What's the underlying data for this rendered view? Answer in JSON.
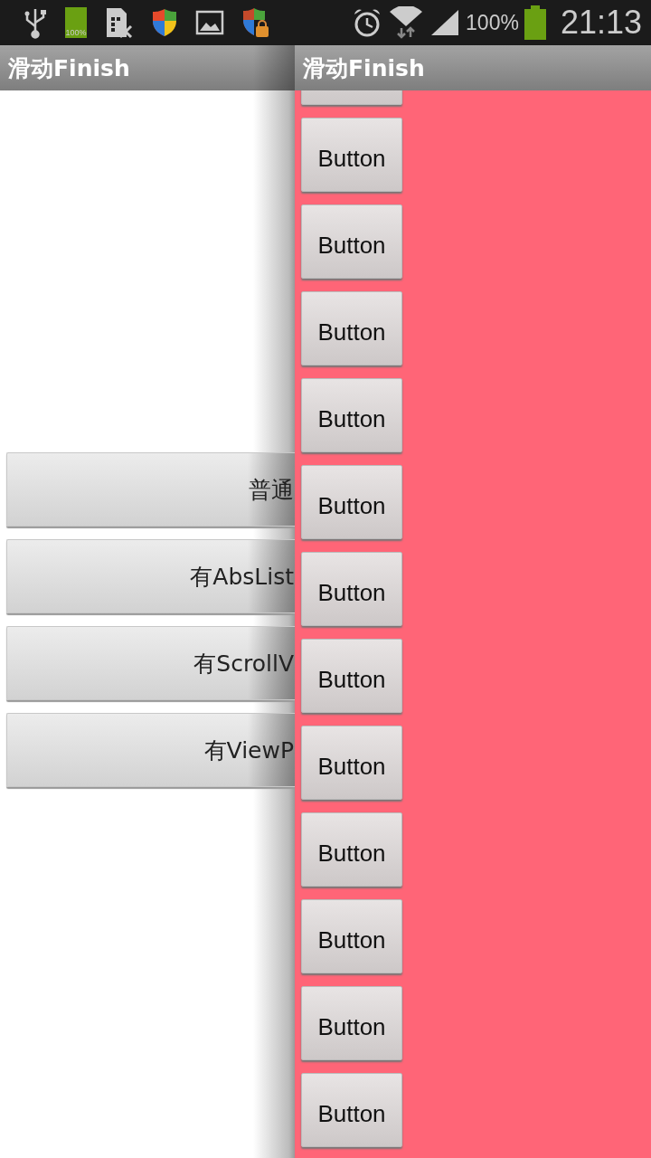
{
  "status_bar": {
    "battery_icon_label": "100%",
    "battery_percent": "100%",
    "time": "21:13"
  },
  "back_activity": {
    "title": "滑动Finish",
    "buttons": [
      "普通",
      "有AbsList",
      "有ScrollV",
      "有ViewP"
    ]
  },
  "front_activity": {
    "title": "滑动Finish",
    "buttons": [
      "Button",
      "Button",
      "Button",
      "Button",
      "Button",
      "Button",
      "Button",
      "Button",
      "Button",
      "Button",
      "Button",
      "Button"
    ]
  }
}
